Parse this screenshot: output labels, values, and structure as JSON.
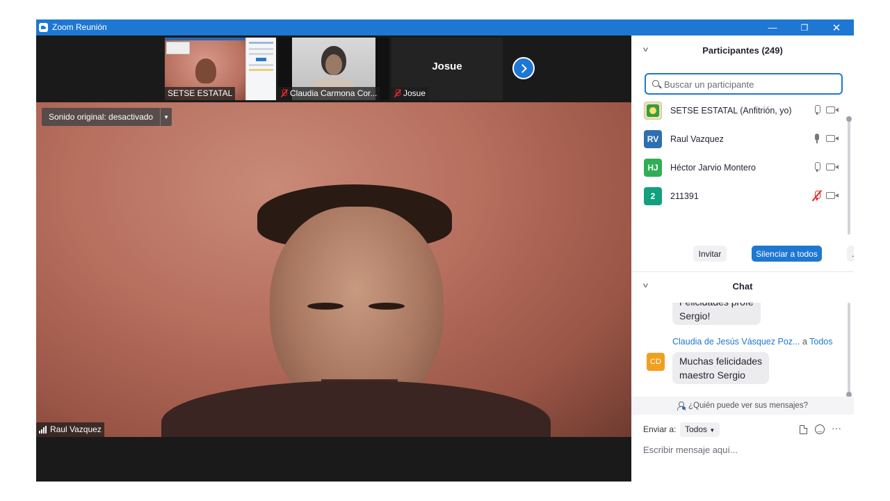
{
  "window": {
    "title": "Zoom Reunión",
    "minimize": "—",
    "restore": "❐",
    "close": "✕"
  },
  "thumbnails": [
    {
      "name": "SETSE ESTATAL",
      "muted": false
    },
    {
      "name": "Claudia Carmona Cor...",
      "muted": true
    },
    {
      "name": "Josue",
      "muted": true,
      "display_name": "Josue"
    }
  ],
  "main_video": {
    "original_sound": "Sonido original: desactivado",
    "speaker": "Raul Vazquez"
  },
  "participants": {
    "header": "Participantes (249)",
    "search_placeholder": "Buscar un participante",
    "list": [
      {
        "name": "SETSE ESTATAL (Anfitrión, yo)",
        "initials": "",
        "avatar_color": "#e9e3b4",
        "mic": "outline"
      },
      {
        "name": "Raul Vazquez",
        "initials": "RV",
        "avatar_color": "#2e6fb1",
        "mic": "active"
      },
      {
        "name": "Héctor Jarvio Montero",
        "initials": "HJ",
        "avatar_color": "#2faf55",
        "mic": "outline"
      },
      {
        "name": "211391",
        "initials": "2",
        "avatar_color": "#12a07f",
        "mic": "muted"
      }
    ],
    "invite": "Invitar",
    "mute_all": "Silenciar a todos",
    "more": "..."
  },
  "chat": {
    "header": "Chat",
    "partial_bubble_top": "Felicidades profe",
    "partial_bubble_bottom": "Sergio!",
    "sender": "Claudia de Jesús Vásquez Poz...",
    "to_word": "a",
    "to_target": "Todos",
    "sender_initials": "CD",
    "sender_color": "#f0a020",
    "message_line1": "Muchas felicidades",
    "message_line2": "maestro Sergio",
    "who_can_see": "¿Quién puede ver sus mensajes?",
    "send_to_label": "Enviar a:",
    "send_to_value": "Todos",
    "input_placeholder": "Escribir mensaje aquí..."
  },
  "colors": {
    "accent": "#1e77d3",
    "muted_red": "#e02828"
  }
}
